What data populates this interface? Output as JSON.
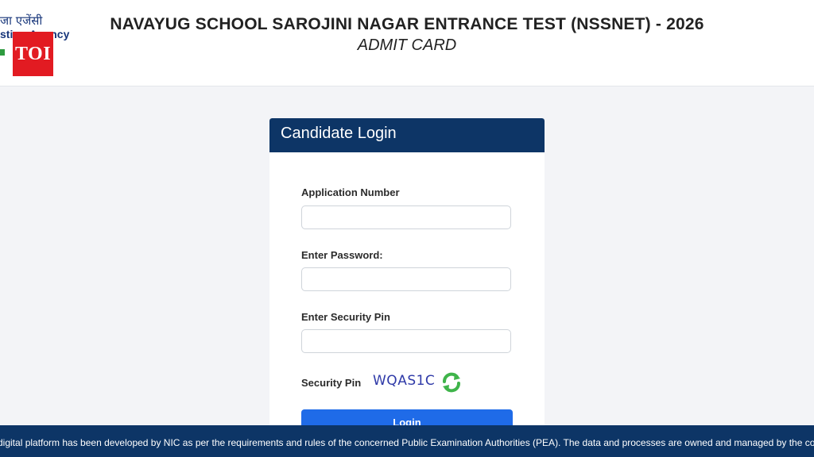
{
  "header": {
    "logo_hindi": "जा एजेंसी",
    "logo_english": "sting Agency",
    "badge": "TOI",
    "title": "NAVAYUG SCHOOL SAROJINI NAGAR ENTRANCE TEST (NSSNET) - 2026",
    "subtitle": "ADMIT CARD"
  },
  "login": {
    "heading": "Candidate Login",
    "application_label": "Application Number",
    "application_value": "",
    "password_label": "Enter Password:",
    "password_value": "",
    "pin_input_label": "Enter Security Pin",
    "pin_input_value": "",
    "pin_label": "Security Pin",
    "pin_code": "WQAS1C",
    "refresh_icon": "refresh-icon",
    "button_label": "Login"
  },
  "footer": {
    "text": "digital platform has been developed by NIC as per the requirements and rules of the concerned Public Examination Authorities (PEA). The data and processes are owned and managed by the concerned"
  },
  "colors": {
    "header_bar": "#0d3566",
    "button": "#1f6be8",
    "badge": "#e21b22",
    "pin_text": "#2f3aa8",
    "refresh": "#3fb44a"
  }
}
